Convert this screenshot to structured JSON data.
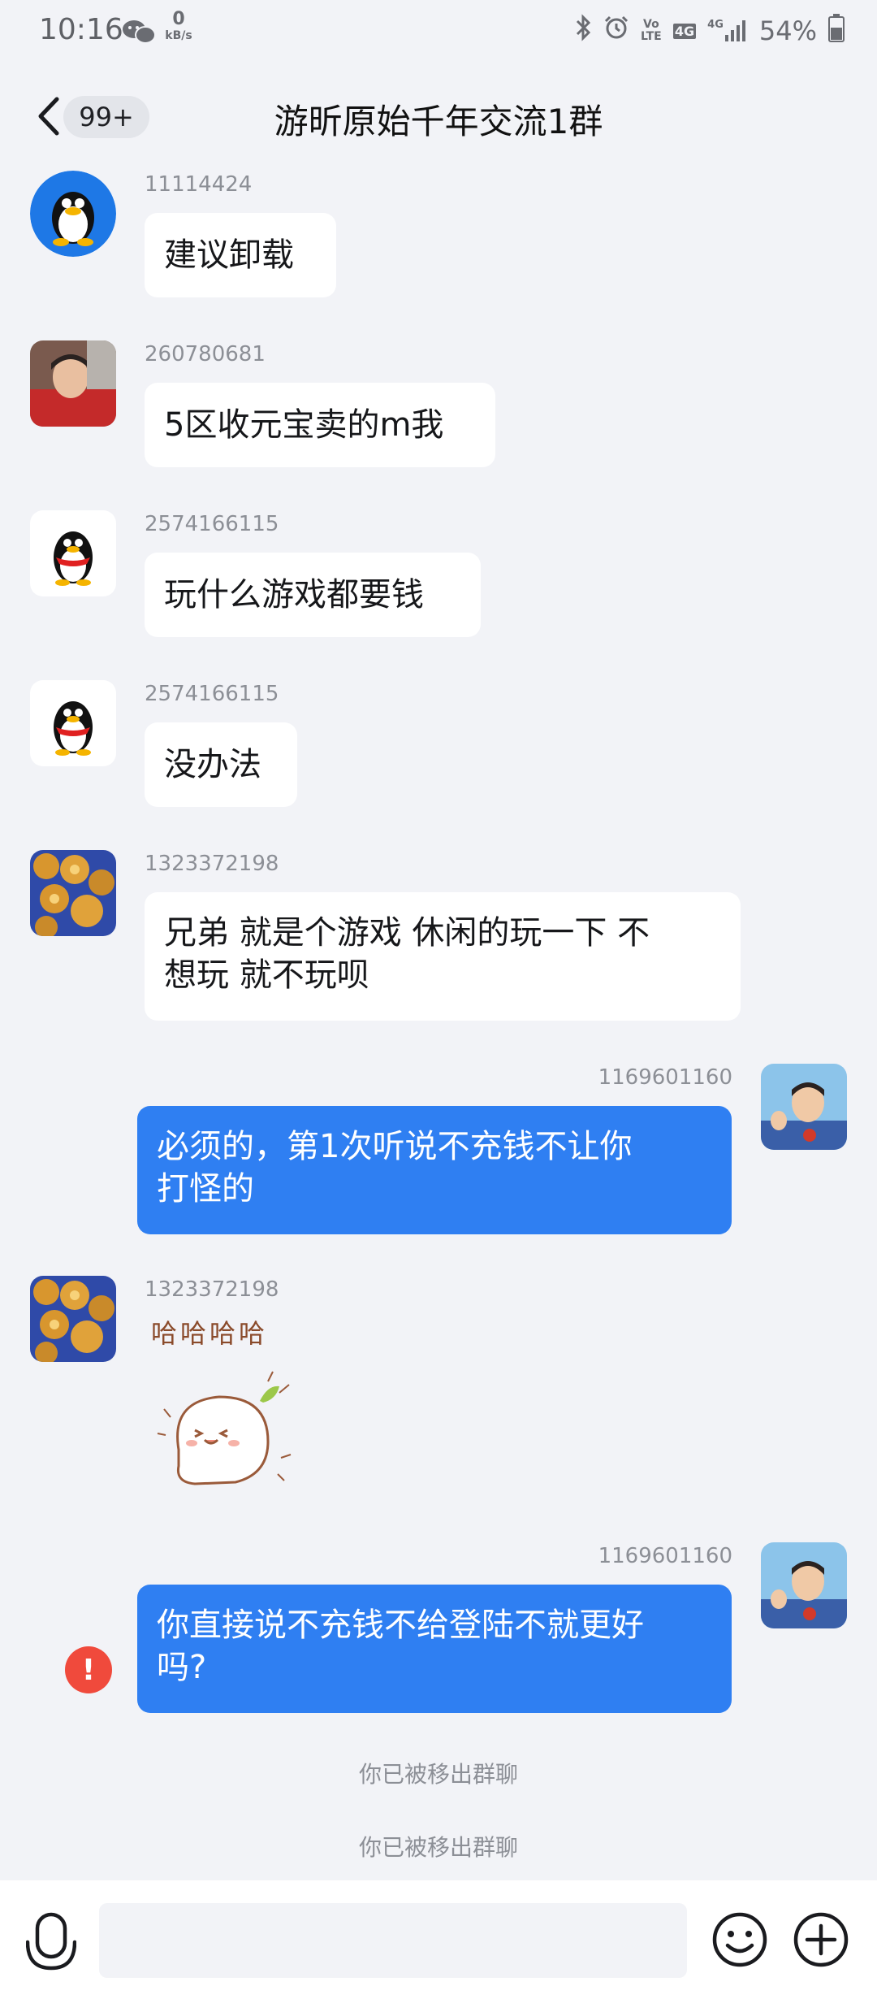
{
  "status_bar": {
    "time": "10:16",
    "net_speed_value": "0",
    "net_speed_unit": "kB/s",
    "volte": "Vo LTE",
    "network_1": "4G",
    "network_2": "4G",
    "battery": "54%"
  },
  "header": {
    "back_badge": "99+",
    "title": "游昕原始千年交流1群"
  },
  "messages": [
    {
      "sender": "11114424",
      "text": "建议卸载"
    },
    {
      "sender": "260780681",
      "text": "5区收元宝卖的m我"
    },
    {
      "sender": "2574166115",
      "text": "玩什么游戏都要钱"
    },
    {
      "sender": "2574166115",
      "text": "没办法"
    },
    {
      "sender": "1323372198",
      "line1": "兄弟 就是个游戏 休闲的玩一下 不",
      "line2": "想玩 就不玩呗"
    },
    {
      "sender": "1169601160",
      "line1": "必须的，第1次听说不充钱不让你",
      "line2": "打怪的"
    },
    {
      "sender": "1323372198",
      "sticker_text": "哈哈哈哈"
    },
    {
      "sender": "1169601160",
      "line1": "你直接说不充钱不给登陆不就更好",
      "line2": "吗?"
    }
  ],
  "system_notices": [
    "你已被移出群聊",
    "你已被移出群聊"
  ],
  "input_bar": {
    "placeholder": ""
  }
}
